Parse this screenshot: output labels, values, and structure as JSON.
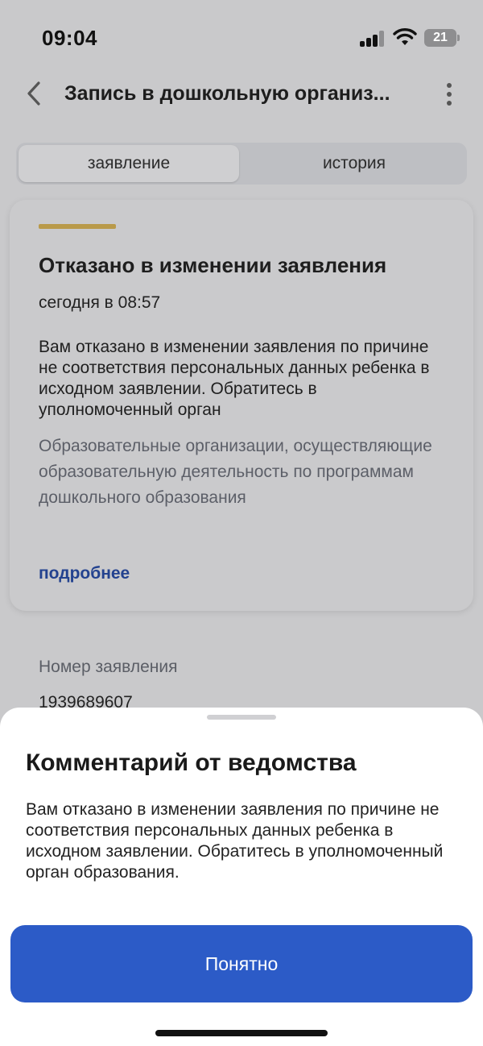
{
  "status_bar": {
    "time": "09:04",
    "battery_level": "21"
  },
  "header": {
    "title": "Запись в дошкольную организ...",
    "back_icon": "chevron-left-icon",
    "menu_icon": "more-vertical-icon"
  },
  "tabs": [
    {
      "label": "заявление",
      "active": true
    },
    {
      "label": "история",
      "active": false
    }
  ],
  "status_card": {
    "accent_color": "#b99a4a",
    "title": "Отказано в изменении заявления",
    "time": "сегодня в 08:57",
    "message": "Вам отказано в изменении заявления по причине не соответствия персональных данных ребенка в исходном заявлении. Обратитесь в уполномоченный орган",
    "organization": "Образовательные организации, осуществляющие образовательную деятельность по программам дошкольного образования",
    "more_link": "подробнее"
  },
  "application_number": {
    "label": "Номер заявления",
    "value": "1939689607"
  },
  "bottom_sheet": {
    "title": "Комментарий от ведомства",
    "message": "Вам отказано в изменении заявления по причине не соответствия персональных данных ребенка в исходном заявлении. Обратитесь в уполномоченный орган образования.",
    "button_label": "Понятно",
    "button_color": "#2c5bc7"
  }
}
